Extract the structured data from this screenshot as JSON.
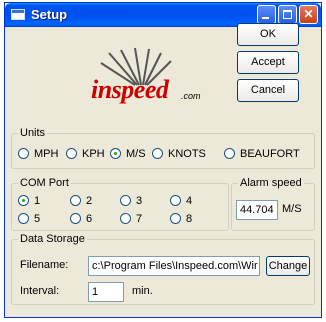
{
  "window": {
    "title": "Setup"
  },
  "logo": {
    "brand": "inspeed",
    "suffix": ".com"
  },
  "buttons": {
    "ok": "OK",
    "accept": "Accept",
    "cancel": "Cancel"
  },
  "units": {
    "legend": "Units",
    "options": [
      "MPH",
      "KPH",
      "M/S",
      "KNOTS",
      "BEAUFORT"
    ],
    "selected": "M/S"
  },
  "com_port": {
    "legend": "COM Port",
    "options": [
      "1",
      "2",
      "3",
      "4",
      "5",
      "6",
      "7",
      "8"
    ],
    "selected": "1"
  },
  "alarm_speed": {
    "legend": "Alarm speed",
    "value": "44.704",
    "unit": "M/S"
  },
  "data_storage": {
    "legend": "Data Storage",
    "filename_label": "Filename:",
    "filename_value": "c:\\Program Files\\Inspeed.com\\Wir",
    "change_label": "Change",
    "interval_label": "Interval:",
    "interval_value": "1",
    "interval_unit": "min."
  },
  "colors": {
    "titlebar": "#0054e3",
    "dialog_bg": "#ece9d8",
    "logo_red": "#cc0000",
    "close_button": "#c9401b"
  }
}
